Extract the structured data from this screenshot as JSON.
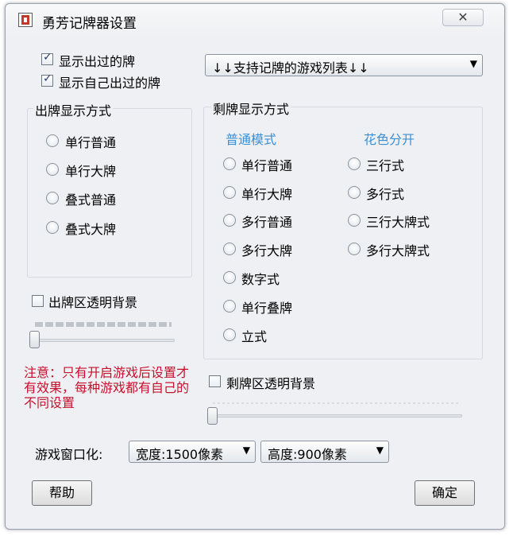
{
  "window": {
    "title": "勇芳记牌器设置",
    "close_glyph": "✕"
  },
  "options": {
    "show_played": {
      "label": "显示出过的牌",
      "checked": true
    },
    "show_own_played": {
      "label": "显示自己出过的牌",
      "checked": true
    }
  },
  "games_dropdown": {
    "label": "↓↓支持记牌的游戏列表↓↓"
  },
  "played_display": {
    "title": "出牌显示方式",
    "options": [
      "单行普通",
      "单行大牌",
      "叠式普通",
      "叠式大牌"
    ]
  },
  "played_transparent": {
    "label": "出牌区透明背景",
    "checked": false
  },
  "remaining_display": {
    "title": "剩牌显示方式",
    "normal_heading": "普通模式",
    "suit_heading": "花色分开",
    "normal_options": [
      "单行普通",
      "单行大牌",
      "多行普通",
      "多行大牌",
      "数字式",
      "单行叠牌",
      "立式"
    ],
    "suit_options": [
      "三行式",
      "多行式",
      "三行大牌式",
      "多行大牌式"
    ]
  },
  "remaining_transparent": {
    "label": "剩牌区透明背景",
    "checked": false
  },
  "notice": {
    "text": "注意：只有开启游戏后设置才有效果，每种游戏都有自己的不同设置"
  },
  "window_size": {
    "label": "游戏窗口化:",
    "width_value": "宽度:1500像素",
    "height_value": "高度:900像素"
  },
  "buttons": {
    "help": "帮助",
    "ok": "确定"
  },
  "colors": {
    "accent_blue": "#3b8fd6",
    "notice_red": "#c8102e"
  }
}
